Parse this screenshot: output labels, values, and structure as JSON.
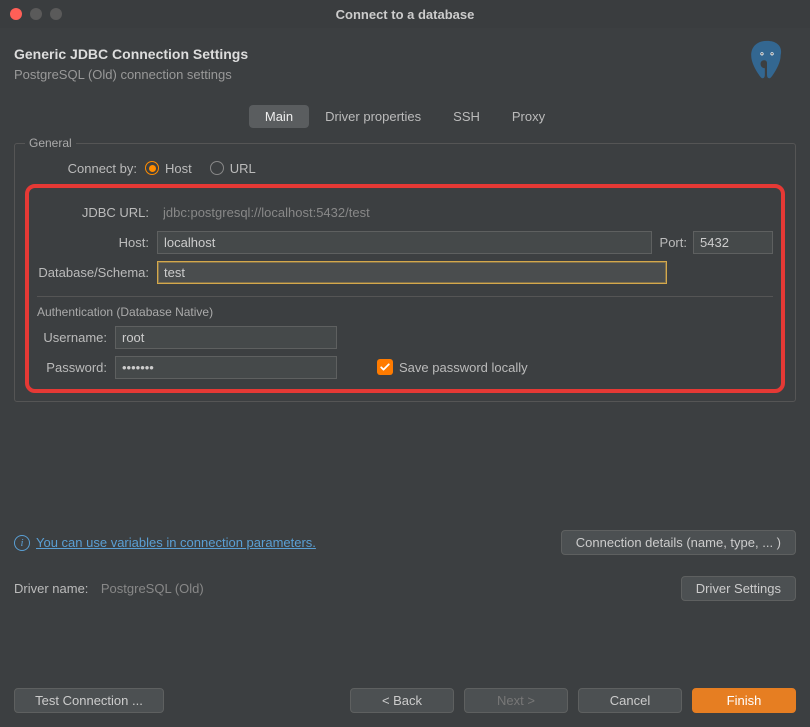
{
  "window": {
    "title": "Connect to a database"
  },
  "header": {
    "title": "Generic JDBC Connection Settings",
    "subtitle": "PostgreSQL (Old) connection settings"
  },
  "tabs": {
    "main": "Main",
    "driver_props": "Driver properties",
    "ssh": "SSH",
    "proxy": "Proxy"
  },
  "general": {
    "legend": "General",
    "connect_by_label": "Connect by:",
    "connect_by_host": "Host",
    "connect_by_url": "URL",
    "jdbc_url_label": "JDBC URL:",
    "jdbc_url_value": "jdbc:postgresql://localhost:5432/test",
    "host_label": "Host:",
    "host_value": "localhost",
    "port_label": "Port:",
    "port_value": "5432",
    "db_label": "Database/Schema:",
    "db_value": "test"
  },
  "auth": {
    "legend": "Authentication (Database Native)",
    "username_label": "Username:",
    "username_value": "root",
    "password_label": "Password:",
    "password_value": "•••••••",
    "save_pw_label": "Save password locally"
  },
  "info": {
    "link_text": "You can use variables in connection parameters.",
    "details_btn": "Connection details (name, type, ... )"
  },
  "driver": {
    "label": "Driver name:",
    "value": "PostgreSQL (Old)",
    "settings_btn": "Driver Settings"
  },
  "footer": {
    "test": "Test Connection ...",
    "back": "< Back",
    "next": "Next >",
    "cancel": "Cancel",
    "finish": "Finish"
  }
}
